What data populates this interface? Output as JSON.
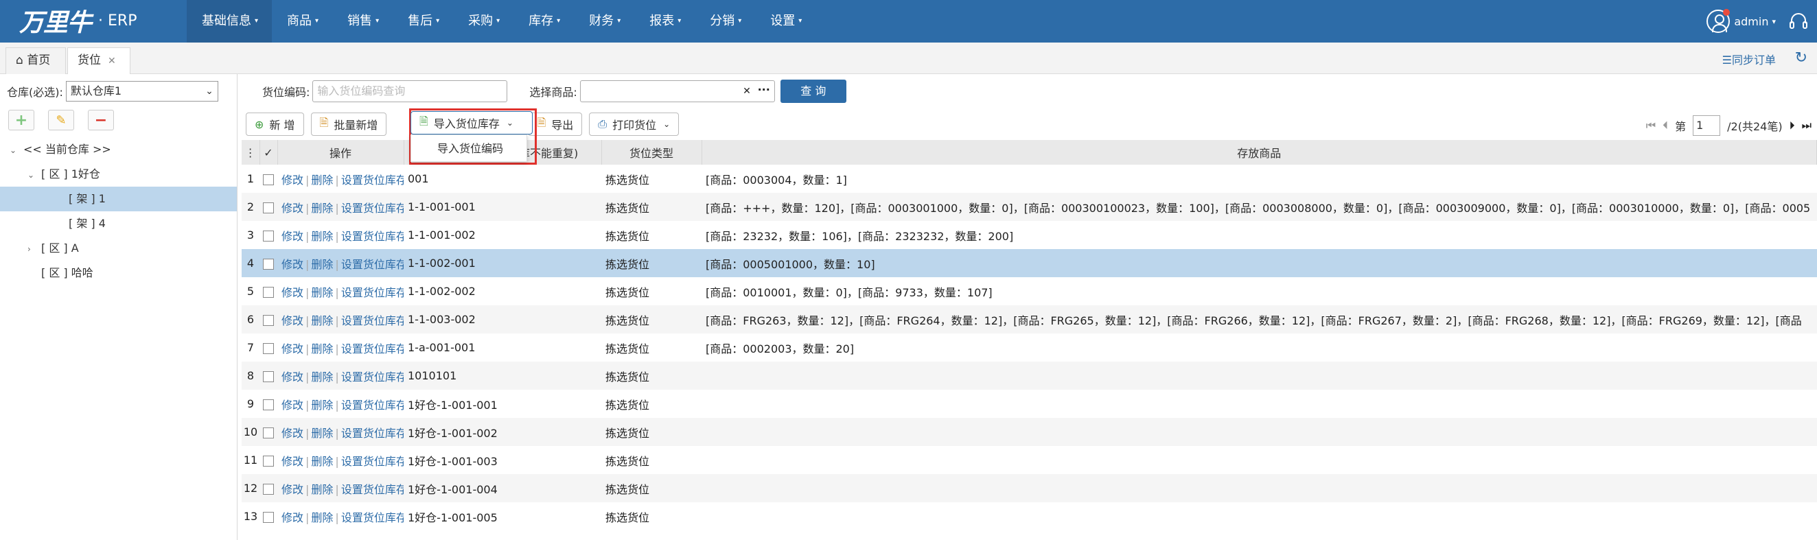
{
  "app": {
    "brand": "万里牛",
    "erp": "· ERP"
  },
  "nav": {
    "items": [
      "基础信息",
      "商品",
      "销售",
      "售后",
      "采购",
      "库存",
      "财务",
      "报表",
      "分销",
      "设置"
    ],
    "active": 0,
    "user": "admin"
  },
  "tabs": {
    "home": "首页",
    "current": "货位",
    "sync": "同步订单"
  },
  "sidebar": {
    "warehouse_label": "仓库(必选):",
    "warehouse_value": "默认仓库1",
    "tree": [
      {
        "label": "<< 当前仓库 >>",
        "level": 0,
        "toggle": "⌄",
        "selected": false
      },
      {
        "label": "[ 区 ] 1好仓",
        "level": 1,
        "toggle": "⌄",
        "selected": false
      },
      {
        "label": "[ 架 ] 1",
        "level": 2,
        "toggle": "",
        "selected": true
      },
      {
        "label": "[ 架 ] 4",
        "level": 2,
        "toggle": "",
        "selected": false
      },
      {
        "label": "[ 区 ] A",
        "level": 1,
        "toggle": "›",
        "selected": false
      },
      {
        "label": "[ 区 ] 哈哈",
        "level": 1,
        "toggle": "",
        "selected": false
      }
    ]
  },
  "search": {
    "code_label": "货位编码:",
    "code_placeholder": "输入货位编码查询",
    "product_label": "选择商品:",
    "query_button": "查 询"
  },
  "toolbar": {
    "add": "新 增",
    "batch_add": "批量新增",
    "import_stock": "导入货位库存",
    "export": "导出",
    "print": "打印货位"
  },
  "dropdown": {
    "item": "导入货位编码"
  },
  "pager": {
    "page_label": "第",
    "page_value": "1",
    "total": "/2(共24笔)"
  },
  "grid": {
    "headers": {
      "ops": "操作",
      "code": "货位编码(同一仓库不能重复)",
      "code_visible": "(同一仓库不能重复)",
      "type": "货位类型",
      "products": "存放商品"
    },
    "actions": {
      "edit": "修改",
      "del": "删除",
      "setstock": "设置货位库存"
    },
    "rows": [
      {
        "n": "1",
        "code": "001",
        "type": "拣选货位",
        "products": "[商品：0003004，数量：1]"
      },
      {
        "n": "2",
        "code": "1-1-001-001",
        "type": "拣选货位",
        "products": "[商品：+++，数量：120]，[商品：0003001000，数量：0]，[商品：000300100023，数量：100]，[商品：0003008000，数量：0]，[商品：0003009000，数量：0]，[商品：0003010000，数量：0]，[商品：0005"
      },
      {
        "n": "3",
        "code": "1-1-001-002",
        "type": "拣选货位",
        "products": "[商品：23232，数量：106]，[商品：2323232，数量：200]"
      },
      {
        "n": "4",
        "code": "1-1-002-001",
        "type": "拣选货位",
        "products": "[商品：0005001000，数量：10]"
      },
      {
        "n": "5",
        "code": "1-1-002-002",
        "type": "拣选货位",
        "products": "[商品：0010001，数量：0]，[商品：9733，数量：107]"
      },
      {
        "n": "6",
        "code": "1-1-003-002",
        "type": "拣选货位",
        "products": "[商品：FRG263，数量：12]，[商品：FRG264，数量：12]，[商品：FRG265，数量：12]，[商品：FRG266，数量：12]，[商品：FRG267，数量：2]，[商品：FRG268，数量：12]，[商品：FRG269，数量：12]，[商品"
      },
      {
        "n": "7",
        "code": "1-a-001-001",
        "type": "拣选货位",
        "products": "[商品：0002003，数量：20]"
      },
      {
        "n": "8",
        "code": "1010101",
        "type": "拣选货位",
        "products": ""
      },
      {
        "n": "9",
        "code": "1好仓-1-001-001",
        "type": "拣选货位",
        "products": ""
      },
      {
        "n": "10",
        "code": "1好仓-1-001-002",
        "type": "拣选货位",
        "products": ""
      },
      {
        "n": "11",
        "code": "1好仓-1-001-003",
        "type": "拣选货位",
        "products": ""
      },
      {
        "n": "12",
        "code": "1好仓-1-001-004",
        "type": "拣选货位",
        "products": ""
      },
      {
        "n": "13",
        "code": "1好仓-1-001-005",
        "type": "拣选货位",
        "products": ""
      }
    ],
    "highlight_row": 4
  },
  "colors": {
    "nav": "#2d6ca8",
    "selected": "#bcd6ec",
    "highlight_border": "#e0312c"
  }
}
